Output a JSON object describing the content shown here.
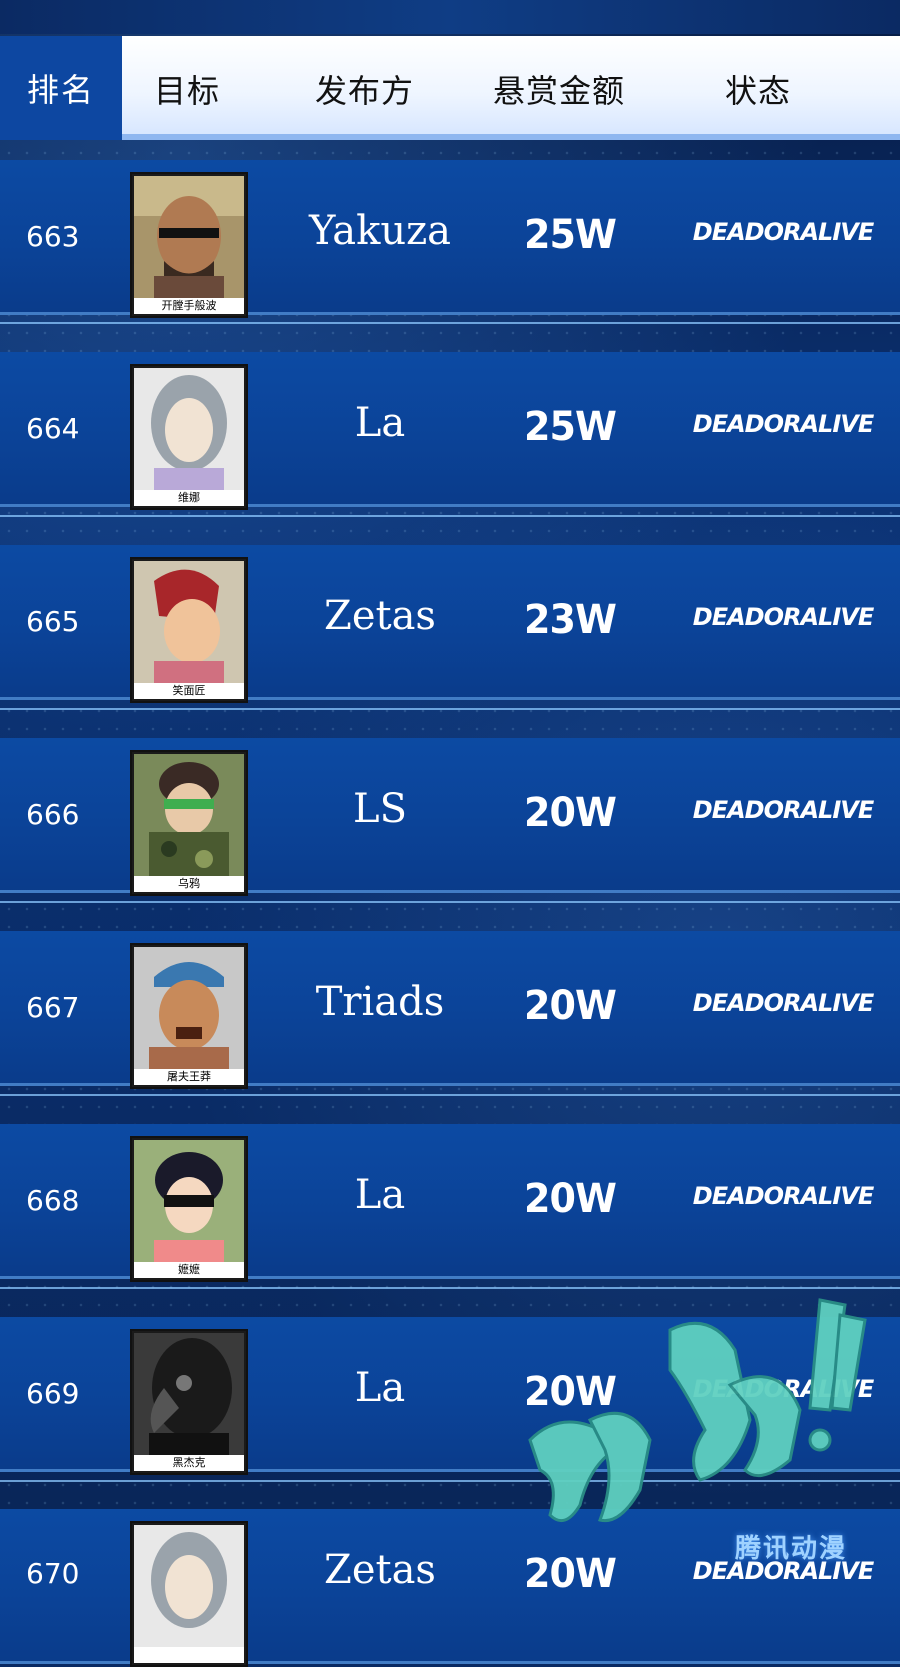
{
  "header": {
    "rank": "排名",
    "target": "目标",
    "publisher": "发布方",
    "bounty": "悬赏金额",
    "status": "状态"
  },
  "rows": [
    {
      "rank": "663",
      "name": "开膛手般波",
      "publisher": "Yakuza",
      "bounty": "25W",
      "status": "DEADORALIVE",
      "avatar_icon": "bald-man-sunglasses"
    },
    {
      "rank": "664",
      "name": "维娜",
      "publisher": "La",
      "bounty": "25W",
      "status": "DEADORALIVE",
      "avatar_icon": "silver-hair-woman"
    },
    {
      "rank": "665",
      "name": "笑面匠",
      "publisher": "Zetas",
      "bounty": "23W",
      "status": "DEADORALIVE",
      "avatar_icon": "red-hair-man"
    },
    {
      "rank": "666",
      "name": "乌鸦",
      "publisher": "LS",
      "bounty": "20W",
      "status": "DEADORALIVE",
      "avatar_icon": "masked-soldier"
    },
    {
      "rank": "667",
      "name": "屠夫王莽",
      "publisher": "Triads",
      "bounty": "20W",
      "status": "DEADORALIVE",
      "avatar_icon": "bandana-man"
    },
    {
      "rank": "668",
      "name": "嬷嬷",
      "publisher": "La",
      "bounty": "20W",
      "status": "DEADORALIVE",
      "avatar_icon": "sunglasses-woman"
    },
    {
      "rank": "669",
      "name": "黑杰克",
      "publisher": "La",
      "bounty": "20W",
      "status": "DEADORALIVE",
      "avatar_icon": "plague-doctor"
    },
    {
      "rank": "670",
      "name": "",
      "publisher": "Zetas",
      "bounty": "20W",
      "status": "DEADORALIVE",
      "avatar_icon": "silver-hair-woman"
    }
  ],
  "stamp": {
    "icon": "brush-stamp"
  },
  "watermark": {
    "text": "腾讯动漫"
  },
  "colors": {
    "row_bg": "#0c4aa3",
    "rank_header_bg": "#0d47a1",
    "header_bg": "#ffffff"
  }
}
